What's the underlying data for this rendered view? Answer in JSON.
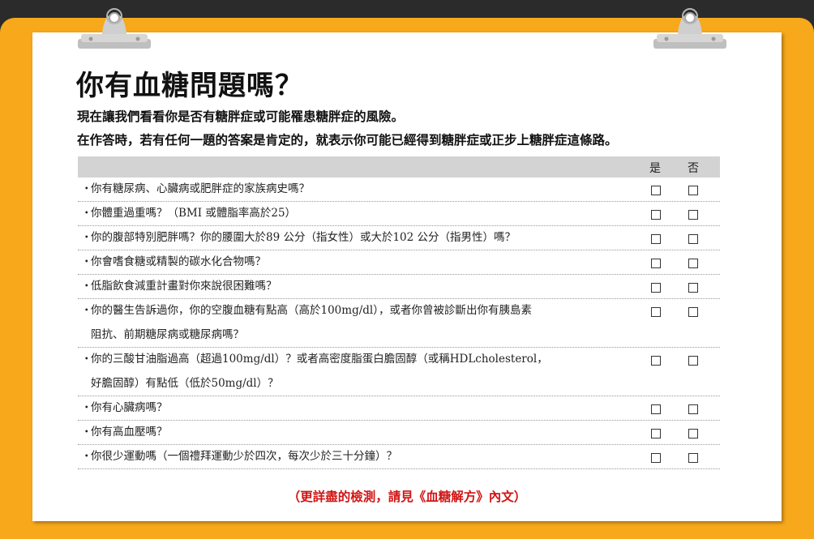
{
  "page": {
    "title": "你有血糖問題嗎？",
    "intro_line1": "現在讓我們看看你是否有糖胖症或可能罹患糖胖症的風險。",
    "intro_line2": "在作答時，若有任何一題的答案是肯定的，就表示你可能已經得到糖胖症或正步上糖胖症這條路。",
    "footer": "（更詳盡的檢測，請見《血糖解方》內文）"
  },
  "table": {
    "header_yes": "是",
    "header_no": "否",
    "bullet": "・",
    "rows": [
      {
        "line1": "你有糖尿病、心臟病或肥胖症的家族病史嗎？",
        "line2": ""
      },
      {
        "line1": "你體重過重嗎？（BMI 或體脂率高於25）",
        "line2": ""
      },
      {
        "line1": "你的腹部特別肥胖嗎？你的腰圍大於89 公分（指女性）或大於102 公分（指男性）嗎？",
        "line2": ""
      },
      {
        "line1": "你會嗜食糖或精製的碳水化合物嗎？",
        "line2": ""
      },
      {
        "line1": "低脂飲食減重計畫對你來說很困難嗎？",
        "line2": ""
      },
      {
        "line1": "你的醫生告訴過你，你的空腹血糖有點高（高於100mg/dl），或者你曾被診斷出你有胰島素",
        "line2": "阻抗、前期糖尿病或糖尿病嗎？"
      },
      {
        "line1": "你的三酸甘油脂過高（超過100mg/dl）？或者高密度脂蛋白膽固醇（或稱HDLcholesterol，",
        "line2": "好膽固醇）有點低（低於50mg/dl）？"
      },
      {
        "line1": "你有心臟病嗎？",
        "line2": ""
      },
      {
        "line1": "你有高血壓嗎？",
        "line2": ""
      },
      {
        "line1": "你很少運動嗎（一個禮拜運動少於四次，每次少於三十分鐘）？",
        "line2": ""
      }
    ]
  },
  "colors": {
    "board": "#f7a81b",
    "paper": "#ffffff",
    "header_bar": "#d3d3d3",
    "footer_text": "#d21414"
  },
  "icons": {
    "clip": "binder-clip-icon",
    "checkbox": "checkbox-icon"
  }
}
